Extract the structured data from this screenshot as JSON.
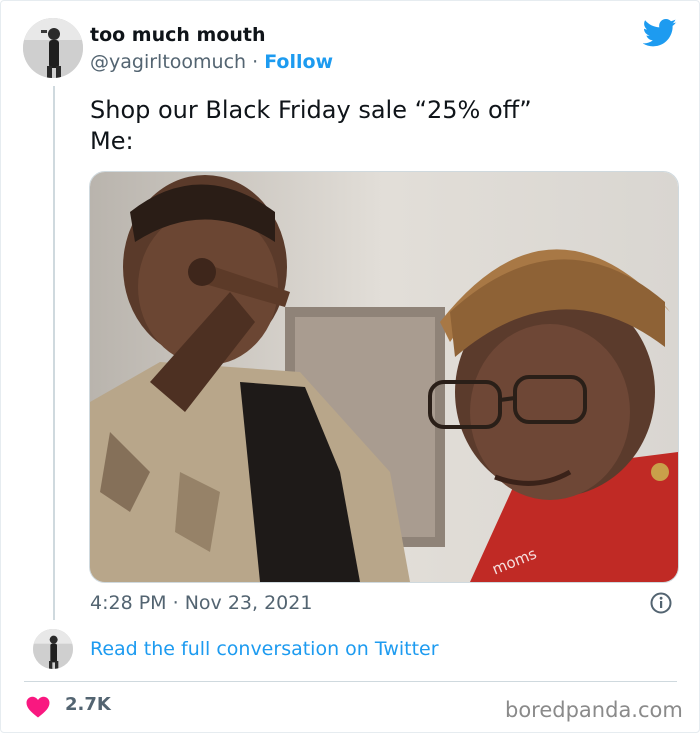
{
  "tweet": {
    "display_name": "too much mouth",
    "handle": "@yagirltoomuch",
    "separator": "·",
    "follow_label": "Follow",
    "text": "Shop our Black Friday sale “25% off”\nMe:",
    "media_watermark": "moms",
    "time": "4:28 PM",
    "date": "Nov 23, 2021",
    "read_more_label": "Read the full conversation on Twitter",
    "like_count": "2.7K"
  },
  "footer": {
    "watermark": "boredpanda.com"
  },
  "icons": {
    "brand": "twitter-bird-icon",
    "info": "info-icon",
    "like": "heart-icon"
  },
  "colors": {
    "accent": "#1d9bf0",
    "heart": "#f91880",
    "secondary_text": "#536471"
  }
}
